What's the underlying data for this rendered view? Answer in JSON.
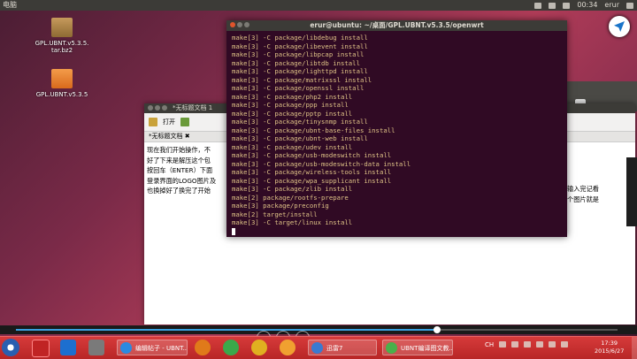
{
  "top_panel": {
    "left_label": "电脑",
    "time": "00:34",
    "user": "erur"
  },
  "desktop_icons": [
    {
      "label": "GPL.UBNT.v5.3.5.\ntar.bz2",
      "type": "archive"
    },
    {
      "label": "GPL.UBNT.v5.3.5",
      "type": "folder"
    }
  ],
  "gedit": {
    "title": "*无标题文档 1",
    "toolbar_open": "打开",
    "tab_label": "*无标题文档",
    "lines": [
      "现在我们开始操作，不",
      "好了下来是解压这个包",
      "按回车（ENTER）下面",
      "登录界面的LOGO图片及",
      "也换掉好了换完了开始"
    ],
    "right_lines": [
      "输入完记看",
      "个图片就是"
    ]
  },
  "terminal": {
    "title": "erur@ubuntu: ~/桌面/GPL.UBNT.v5.3.5/openwrt",
    "lines": [
      "make[3] -C package/libdebug install",
      "make[3] -C package/libevent install",
      "make[3] -C package/libpcap install",
      "make[3] -C package/libtdb install",
      "make[3] -C package/lighttpd install",
      "make[3] -C package/matrixssl install",
      "make[3] -C package/openssl install",
      "make[3] -C package/php2 install",
      "make[3] -C package/ppp install",
      "make[3] -C package/pptp install",
      "make[3] -C package/tinysnmp install",
      "make[3] -C package/ubnt-base-files install",
      "make[3] -C package/ubnt-web install",
      "make[3] -C package/udev install",
      "make[3] -C package/usb-modeswitch install",
      "make[3] -C package/usb-modeswitch-data install",
      "make[3] -C package/wireless-tools install",
      "make[3] -C package/wpa_supplicant install",
      "make[3] -C package/zlib install",
      "make[2] package/rootfs-prepare",
      "make[3] package/preconfig",
      "make[2] target/install",
      "make[3] -C target/linux install"
    ]
  },
  "player": {
    "progress": 0.7
  },
  "taskbar": {
    "tasks": [
      {
        "label": "编辑帖子 - UBNT..."
      },
      {
        "label": "迅雷7"
      },
      {
        "label": "UBNT编译图文教..."
      }
    ],
    "tray_text": "CH",
    "clock_time": "17:39",
    "clock_date": "2015/6/27"
  },
  "colors": {
    "terminal_bg": "#300a24",
    "terminal_text": "#e0c487",
    "taskbar": "#c62f2f"
  }
}
